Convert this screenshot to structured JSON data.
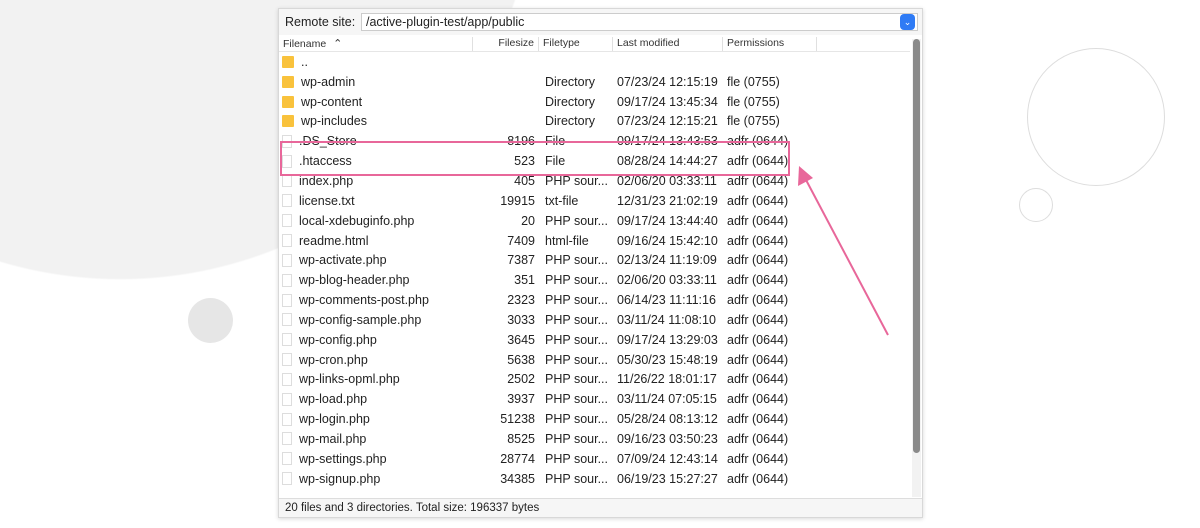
{
  "remote_site": {
    "label": "Remote site:",
    "path": "/active-plugin-test/app/public"
  },
  "columns": [
    "Filename",
    "Filesize",
    "Filetype",
    "Last modified",
    "Permissions"
  ],
  "sort_icon": "chevron-up-icon",
  "rows": [
    {
      "name": "..",
      "size": "",
      "type": "",
      "modified": "",
      "perms": "",
      "kind": "folder"
    },
    {
      "name": "wp-admin",
      "size": "",
      "type": "Directory",
      "modified": "07/23/24 12:15:19",
      "perms": "fle (0755)",
      "kind": "folder"
    },
    {
      "name": "wp-content",
      "size": "",
      "type": "Directory",
      "modified": "09/17/24 13:45:34",
      "perms": "fle (0755)",
      "kind": "folder"
    },
    {
      "name": "wp-includes",
      "size": "",
      "type": "Directory",
      "modified": "07/23/24 12:15:21",
      "perms": "fle (0755)",
      "kind": "folder"
    },
    {
      "name": ".DS_Store",
      "size": "8196",
      "type": "File",
      "modified": "09/17/24 13:43:53",
      "perms": "adfr (0644)",
      "kind": "file"
    },
    {
      "name": ".htaccess",
      "size": "523",
      "type": "File",
      "modified": "08/28/24 14:44:27",
      "perms": "adfr (0644)",
      "kind": "file"
    },
    {
      "name": "index.php",
      "size": "405",
      "type": "PHP sour...",
      "modified": "02/06/20 03:33:11",
      "perms": "adfr (0644)",
      "kind": "file"
    },
    {
      "name": "license.txt",
      "size": "19915",
      "type": "txt-file",
      "modified": "12/31/23 21:02:19",
      "perms": "adfr (0644)",
      "kind": "file"
    },
    {
      "name": "local-xdebuginfo.php",
      "size": "20",
      "type": "PHP sour...",
      "modified": "09/17/24 13:44:40",
      "perms": "adfr (0644)",
      "kind": "file"
    },
    {
      "name": "readme.html",
      "size": "7409",
      "type": "html-file",
      "modified": "09/16/24 15:42:10",
      "perms": "adfr (0644)",
      "kind": "file"
    },
    {
      "name": "wp-activate.php",
      "size": "7387",
      "type": "PHP sour...",
      "modified": "02/13/24 11:19:09",
      "perms": "adfr (0644)",
      "kind": "file"
    },
    {
      "name": "wp-blog-header.php",
      "size": "351",
      "type": "PHP sour...",
      "modified": "02/06/20 03:33:11",
      "perms": "adfr (0644)",
      "kind": "file"
    },
    {
      "name": "wp-comments-post.php",
      "size": "2323",
      "type": "PHP sour...",
      "modified": "06/14/23 11:11:16",
      "perms": "adfr (0644)",
      "kind": "file"
    },
    {
      "name": "wp-config-sample.php",
      "size": "3033",
      "type": "PHP sour...",
      "modified": "03/11/24 11:08:10",
      "perms": "adfr (0644)",
      "kind": "file"
    },
    {
      "name": "wp-config.php",
      "size": "3645",
      "type": "PHP sour...",
      "modified": "09/17/24 13:29:03",
      "perms": "adfr (0644)",
      "kind": "file"
    },
    {
      "name": "wp-cron.php",
      "size": "5638",
      "type": "PHP sour...",
      "modified": "05/30/23 15:48:19",
      "perms": "adfr (0644)",
      "kind": "file"
    },
    {
      "name": "wp-links-opml.php",
      "size": "2502",
      "type": "PHP sour...",
      "modified": "11/26/22 18:01:17",
      "perms": "adfr (0644)",
      "kind": "file"
    },
    {
      "name": "wp-load.php",
      "size": "3937",
      "type": "PHP sour...",
      "modified": "03/11/24 07:05:15",
      "perms": "adfr (0644)",
      "kind": "file"
    },
    {
      "name": "wp-login.php",
      "size": "51238",
      "type": "PHP sour...",
      "modified": "05/28/24 08:13:12",
      "perms": "adfr (0644)",
      "kind": "file"
    },
    {
      "name": "wp-mail.php",
      "size": "8525",
      "type": "PHP sour...",
      "modified": "09/16/23 03:50:23",
      "perms": "adfr (0644)",
      "kind": "file"
    },
    {
      "name": "wp-settings.php",
      "size": "28774",
      "type": "PHP sour...",
      "modified": "07/09/24 12:43:14",
      "perms": "adfr (0644)",
      "kind": "file"
    },
    {
      "name": "wp-signup.php",
      "size": "34385",
      "type": "PHP sour...",
      "modified": "06/19/23 15:27:27",
      "perms": "adfr (0644)",
      "kind": "file"
    }
  ],
  "status": "20 files and 3 directories. Total size: 196337 bytes",
  "highlight_color": "#e8679a",
  "accent": "#2f7bf5"
}
